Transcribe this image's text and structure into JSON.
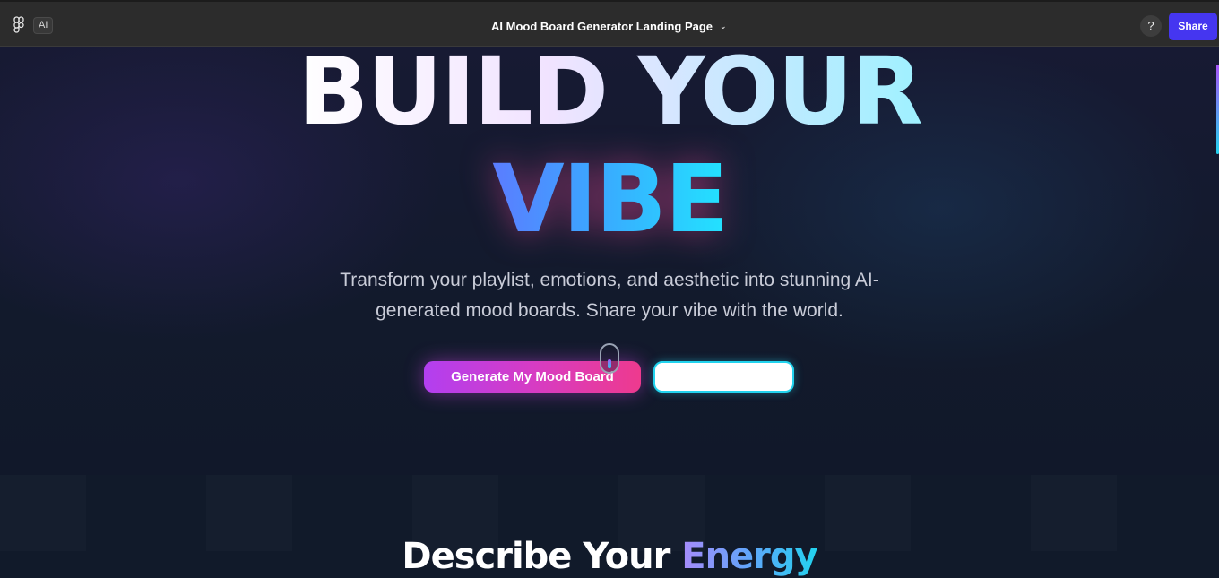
{
  "app": {
    "ai_badge": "AI",
    "title": "AI Mood Board Generator Landing Page",
    "help": "?",
    "share": "Share"
  },
  "hero": {
    "line1": "BUILD YOUR",
    "line2": "VIBE",
    "subtitle": "Transform your playlist, emotions, and aesthetic into stunning AI-generated mood boards. Share your vibe with the world.",
    "primary_cta": "Generate My Mood Board",
    "secondary_cta": ""
  },
  "next_section": {
    "title_plain": "Describe Your ",
    "title_accent": "Energy"
  },
  "colors": {
    "toolbar": "#2c2c2c",
    "share_button": "#4536f0",
    "primary_gradient_start": "#b23ff0",
    "primary_gradient_end": "#ee3a8e",
    "secondary_border": "#22d3ee"
  },
  "icons": {
    "logo": "figma-logo-icon",
    "chevron": "chevron-down-icon",
    "scroll": "mouse-scroll-icon"
  }
}
